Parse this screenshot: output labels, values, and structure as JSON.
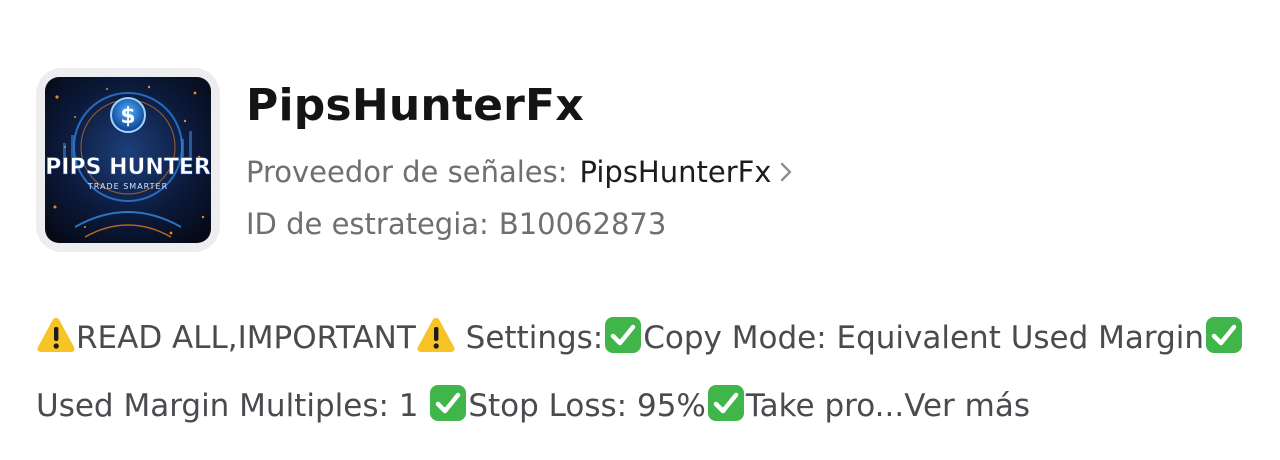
{
  "strategy": {
    "name": "PipsHunterFx",
    "provider_label": "Proveedor de señales:",
    "provider_name": "PipsHunterFx",
    "id_label": "ID de estrategia:",
    "id_value": "B10062873"
  },
  "logo": {
    "title": "PIPS HUNTER",
    "subtitle": "TRADE SMARTER",
    "symbol": "$"
  },
  "description": {
    "segments": [
      {
        "type": "icon",
        "icon": "warning-icon"
      },
      {
        "type": "text",
        "text": "READ ALL,IMPORTANT"
      },
      {
        "type": "icon",
        "icon": "warning-icon"
      },
      {
        "type": "text",
        "text": " Settings:"
      },
      {
        "type": "icon",
        "icon": "check-mark-icon"
      },
      {
        "type": "text",
        "text": "Copy Mode: Equivalent Used Margin"
      },
      {
        "type": "icon",
        "icon": "check-mark-icon"
      },
      {
        "type": "text",
        "text": "Used Margin Multiples: 1 "
      },
      {
        "type": "icon",
        "icon": "check-mark-icon"
      },
      {
        "type": "text",
        "text": "Stop Loss: 95%"
      },
      {
        "type": "icon",
        "icon": "check-mark-icon"
      },
      {
        "type": "text",
        "text": "Take pro..."
      }
    ],
    "more_label": "Ver más"
  },
  "colors": {
    "warning": "#f7c325",
    "check": "#3fb54a"
  }
}
